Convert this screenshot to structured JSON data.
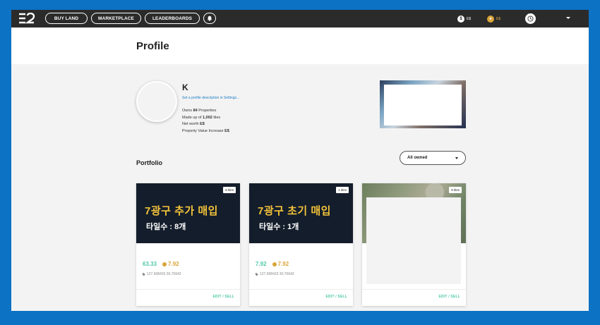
{
  "nav": {
    "buttons": [
      "BUY LAND",
      "MARKETPLACE",
      "LEADERBOARDS"
    ],
    "balance_essence": "E$",
    "balance_gold": "E$"
  },
  "page": {
    "title": "Profile"
  },
  "profile": {
    "name": "K",
    "description_link": "Set a profile description in Settings...",
    "owns_prefix": "Owns ",
    "owns_value": "84",
    "owns_suffix": " Properties",
    "made_prefix": "Made up of ",
    "made_value": "1,002",
    "made_suffix": " tiles",
    "networth_prefix": "Net worth ",
    "networth_value": "E$",
    "pvi_prefix": "Property Value Increase ",
    "pvi_value": "E$"
  },
  "portfolio": {
    "title": "Portfolio",
    "filter": "All owned",
    "cards": [
      {
        "tiles": "8 tiles",
        "image_line1": "7광구 추가 매입",
        "image_line2": "타일수 : 8개",
        "price": "63.33",
        "gold_price": "7.92",
        "coords": "127.608433 30.70642",
        "action": "EDIT / SELL"
      },
      {
        "tiles": "1 tiles",
        "image_line1": "7광구 초기 매입",
        "image_line2": "타일수 : 1개",
        "price": "7.92",
        "gold_price": "7.92",
        "coords": "127.608433 30.70642",
        "action": "EDIT / SELL"
      },
      {
        "tiles": "9 tiles",
        "action": "EDIT / SELL"
      }
    ]
  },
  "colors": {
    "accent_green": "#4ec9a8",
    "gold": "#d9a53a",
    "link_blue": "#1f7fc4",
    "nav_bg": "#2b2b2b",
    "outer_blue": "#0b72c4"
  }
}
